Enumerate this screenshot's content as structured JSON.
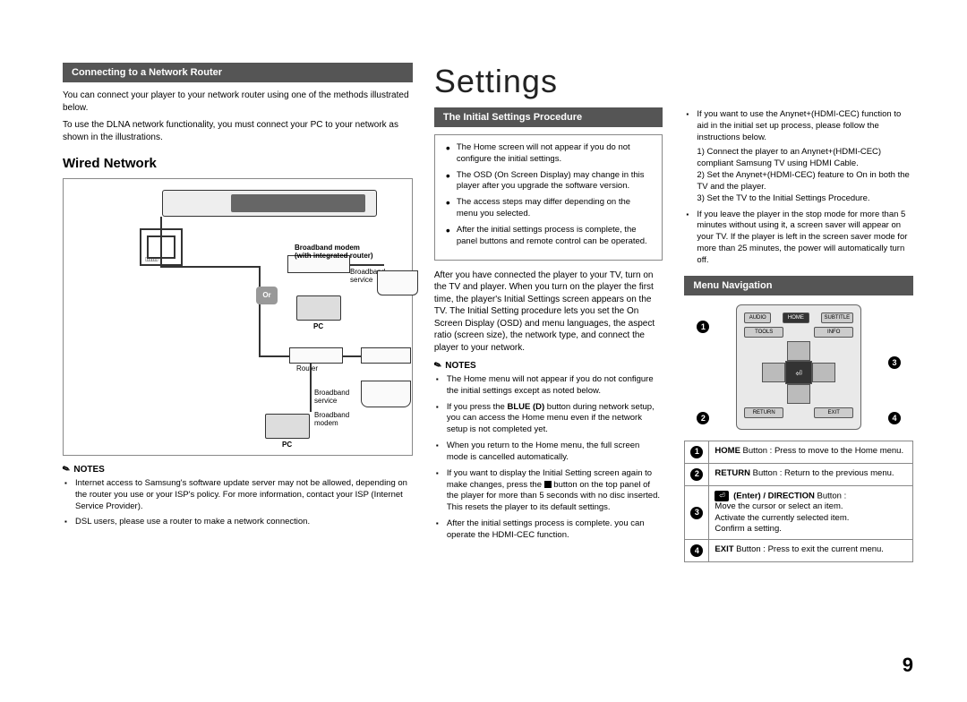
{
  "left": {
    "header": "Connecting to a Network Router",
    "intro1": "You can connect your player to your network router using one of the methods illustrated below.",
    "intro2": "To use the DLNA network functionality, you must connect your PC to your network as shown in the illustrations.",
    "wired_heading": "Wired Network",
    "diagram": {
      "or": "Or",
      "modem_router": "Broadband modem\n(with integrated router)",
      "broadband_service": "Broadband\nservice",
      "router": "Router",
      "broadband_modem": "Broadband\nmodem",
      "pc": "PC"
    },
    "notes_label": "NOTES",
    "notes": [
      "Internet access to Samsung's software update server may not be allowed, depending on the router you use or your ISP's policy. For more information, contact your ISP (Internet Service Provider).",
      "DSL users, please use a router to make a network connection."
    ]
  },
  "mid": {
    "title": "Settings",
    "header": "The Initial Settings Procedure",
    "box_items": [
      "The Home screen will not appear if you do not configure the initial settings.",
      "The OSD (On Screen Display) may change in this player after you upgrade the software version.",
      "The access steps may differ depending on the menu you selected.",
      "After the initial settings process is complete, the panel buttons and remote control can be operated."
    ],
    "para": "After you have connected the player to your TV, turn on the TV and player. When you turn on the player the first time, the player's Initial Settings screen appears on the TV. The Initial Setting procedure lets you set the On Screen Display (OSD) and menu languages, the aspect ratio (screen size), the network type, and connect the player to your network.",
    "notes_label": "NOTES",
    "notes_pre": [
      "The Home menu will not appear if you do not configure the initial settings except as noted below."
    ],
    "note_blue": "If you press the BLUE (D) button during network setup, you can access the Home menu even if the network setup is not completed yet.",
    "note_home_return": "When you return to the Home menu, the full screen mode is cancelled automatically.",
    "note_initial_1": "If you want to display the Initial Setting screen again to make changes, press the ",
    "note_initial_2": " button on the top panel of the player for more than 5 seconds with no disc inserted. This resets the player to its default settings.",
    "note_hdmi": "After the initial settings process is complete. you can operate the HDMI-CEC function."
  },
  "right": {
    "anynet_intro": "If you want to use the Anynet+(HDMI-CEC) function to aid in the initial set up process, please follow the instructions below.",
    "anynet_steps": [
      "1) Connect the player to an Anynet+(HDMI-CEC) compliant Samsung TV using HDMI Cable.",
      "2) Set the Anynet+(HDMI-CEC) feature to On in both the TV and the player.",
      "3) Set the TV to the Initial Settings Procedure."
    ],
    "stop_note": "If you leave the player in the stop mode for more than 5 minutes without using it, a screen saver will appear on your TV. If the player is left in the screen saver mode for more than 25 minutes, the power will automatically turn off.",
    "menu_header": "Menu Navigation",
    "remote": {
      "audio": "AUDIO",
      "home": "HOME",
      "subtitle": "SUBTITLE",
      "tools": "TOOLS",
      "info": "INFO",
      "return": "RETURN",
      "exit": "EXIT",
      "enter": "⏎"
    },
    "table": {
      "r1_label": "HOME",
      "r1_text": " Button : Press to move to the Home menu.",
      "r2_label": "RETURN",
      "r2_text": " Button : Return to the previous menu.",
      "r3_label": "(Enter) / DIRECTION",
      "r3_text": " Button :",
      "r3_lines": "Move the cursor or select an item.\nActivate the currently selected item.\nConfirm a setting.",
      "r4_label": "EXIT",
      "r4_text": " Button : Press to exit the current menu."
    }
  },
  "page_number": "9"
}
